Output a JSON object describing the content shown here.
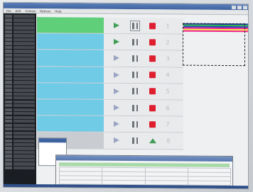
{
  "window": {
    "title": ""
  },
  "menu": [
    "File",
    "Edit",
    "Control",
    "Options",
    "Help"
  ],
  "log_lines": 40,
  "rows": [
    {
      "status": "green",
      "playing": true,
      "pause_selected": true,
      "end": "stop",
      "number": "1",
      "lines": [
        "",
        "",
        "",
        ""
      ]
    },
    {
      "status": "blue",
      "playing": true,
      "pause_selected": false,
      "end": "stop",
      "number": "2",
      "lines": [
        "",
        "",
        "",
        ""
      ]
    },
    {
      "status": "blue",
      "playing": false,
      "pause_selected": false,
      "end": "stop",
      "number": "3",
      "lines": [
        "",
        "",
        "",
        ""
      ]
    },
    {
      "status": "blue",
      "playing": false,
      "pause_selected": false,
      "end": "stop",
      "number": "4",
      "lines": [
        "",
        "",
        "",
        ""
      ]
    },
    {
      "status": "blue",
      "playing": false,
      "pause_selected": false,
      "end": "stop",
      "number": "5",
      "lines": [
        "",
        "",
        "",
        ""
      ]
    },
    {
      "status": "blue",
      "playing": false,
      "pause_selected": false,
      "end": "stop",
      "number": "6",
      "lines": [
        "",
        "",
        "",
        ""
      ]
    },
    {
      "status": "blue",
      "playing": false,
      "pause_selected": false,
      "end": "stop",
      "number": "7",
      "lines": [
        "",
        "",
        "",
        ""
      ]
    },
    {
      "status": "grey",
      "playing": false,
      "pause_selected": false,
      "end": "eject",
      "number": "8",
      "lines": [
        "",
        "",
        "",
        ""
      ]
    }
  ],
  "right_blocks": [
    {
      "color": "#1f3fa8",
      "lines": 2
    },
    {
      "color": "#28b04d",
      "lines": 4
    },
    {
      "color": "#2b42b8",
      "lines": 3
    },
    {
      "color": "#f01f8f",
      "lines": 3
    },
    {
      "color": "#f3ef4a",
      "lines": 31
    },
    {
      "color": "#f01f8f",
      "lines": 4
    }
  ],
  "colors": {
    "row_green": "#5fcf79",
    "row_blue": "#6fcbe6",
    "stop_red": "#de1f2f",
    "play_green": "#3f9d55"
  },
  "dialog": {
    "title": "",
    "lines": [
      "",
      "",
      "",
      ""
    ]
  },
  "bottom_window": {
    "title": "",
    "rows": 5,
    "cols": 4
  }
}
